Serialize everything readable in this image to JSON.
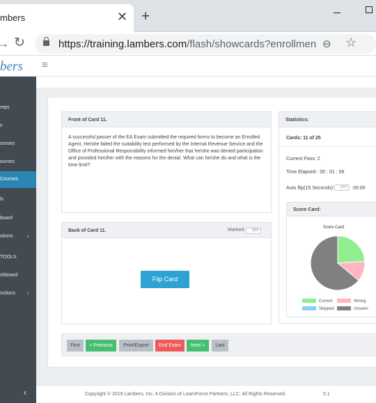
{
  "browser": {
    "tab_title": "mbers",
    "close_glyph": "✕",
    "new_tab_glyph": "+",
    "back_glyph": "→",
    "reload_glyph": "↻",
    "url_domain": "https://training.lambers.com",
    "url_path": "/flash/showcards?enrollment...",
    "zoom_glyph": "⊖",
    "star_glyph": "☆"
  },
  "header": {
    "logo": "bers",
    "menu_glyph": "≡"
  },
  "sidebar": {
    "items": [
      {
        "label": "reps",
        "active": false
      },
      {
        "label": "s",
        "active": false
      },
      {
        "label": "ourses",
        "active": false
      },
      {
        "label": "ourses",
        "active": false
      },
      {
        "label": "Courses",
        "active": true
      },
      {
        "label": "ls",
        "active": false
      },
      {
        "label": "board",
        "active": false
      },
      {
        "label": "otions",
        "active": false,
        "chevron": "‹"
      },
      {
        "label": "TOOLS",
        "active": false
      },
      {
        "label": "shboard",
        "active": false
      },
      {
        "label": "nctions",
        "active": false,
        "chevron": "‹"
      }
    ],
    "collapse_glyph": "‹"
  },
  "front": {
    "title": "Front of Card 11.",
    "text": "A successful passer of the EA Exam submitted the required forms to become an Enrolled Agent. He/she failed the suitability test performed by the Internal Revenue Service and the Office of Professional Responsibility informed him/her that he/she was denied participation and provided him/her with the reasons for the denial. What can he/she do and what is the time limit?"
  },
  "back": {
    "title": "Back of Card 11.",
    "marked_label": "Marked",
    "marked_switch": "OFF",
    "flip_label": "Flip Card"
  },
  "stats": {
    "title": "Statistics:",
    "cards": "Cards: 11 of 25",
    "current_pass": "Current Pass: 2",
    "time_elapsed": "Time Elapsed : 00 : 01 : 06",
    "autoflip_label": "Auto flip(15 Seconds):",
    "autoflip_switch": "OFF",
    "autoflip_time": "00:00",
    "scorecard_title": "Score Card:"
  },
  "chart_data": {
    "type": "pie",
    "title": "Score Card",
    "series": [
      {
        "name": "Correct",
        "value": 24,
        "color": "#90ee90"
      },
      {
        "name": "Wrong",
        "value": 12,
        "color": "#ffb6c1"
      },
      {
        "name": "Skipped",
        "value": 0,
        "color": "#87cefa"
      },
      {
        "name": "Unseen",
        "value": 64,
        "color": "#808080"
      }
    ],
    "legend_placement": "bottom"
  },
  "pager": {
    "first": "First",
    "previous": "< Previous",
    "print": "Print\\Export",
    "end": "End Exam",
    "next": "Next >",
    "last": "Last"
  },
  "footer": {
    "copyright": "Copyright © 2019 Lambers, Inc. A Division of LearnForce Partners, LLC. All Rights Reserved.",
    "version": "5.1"
  }
}
